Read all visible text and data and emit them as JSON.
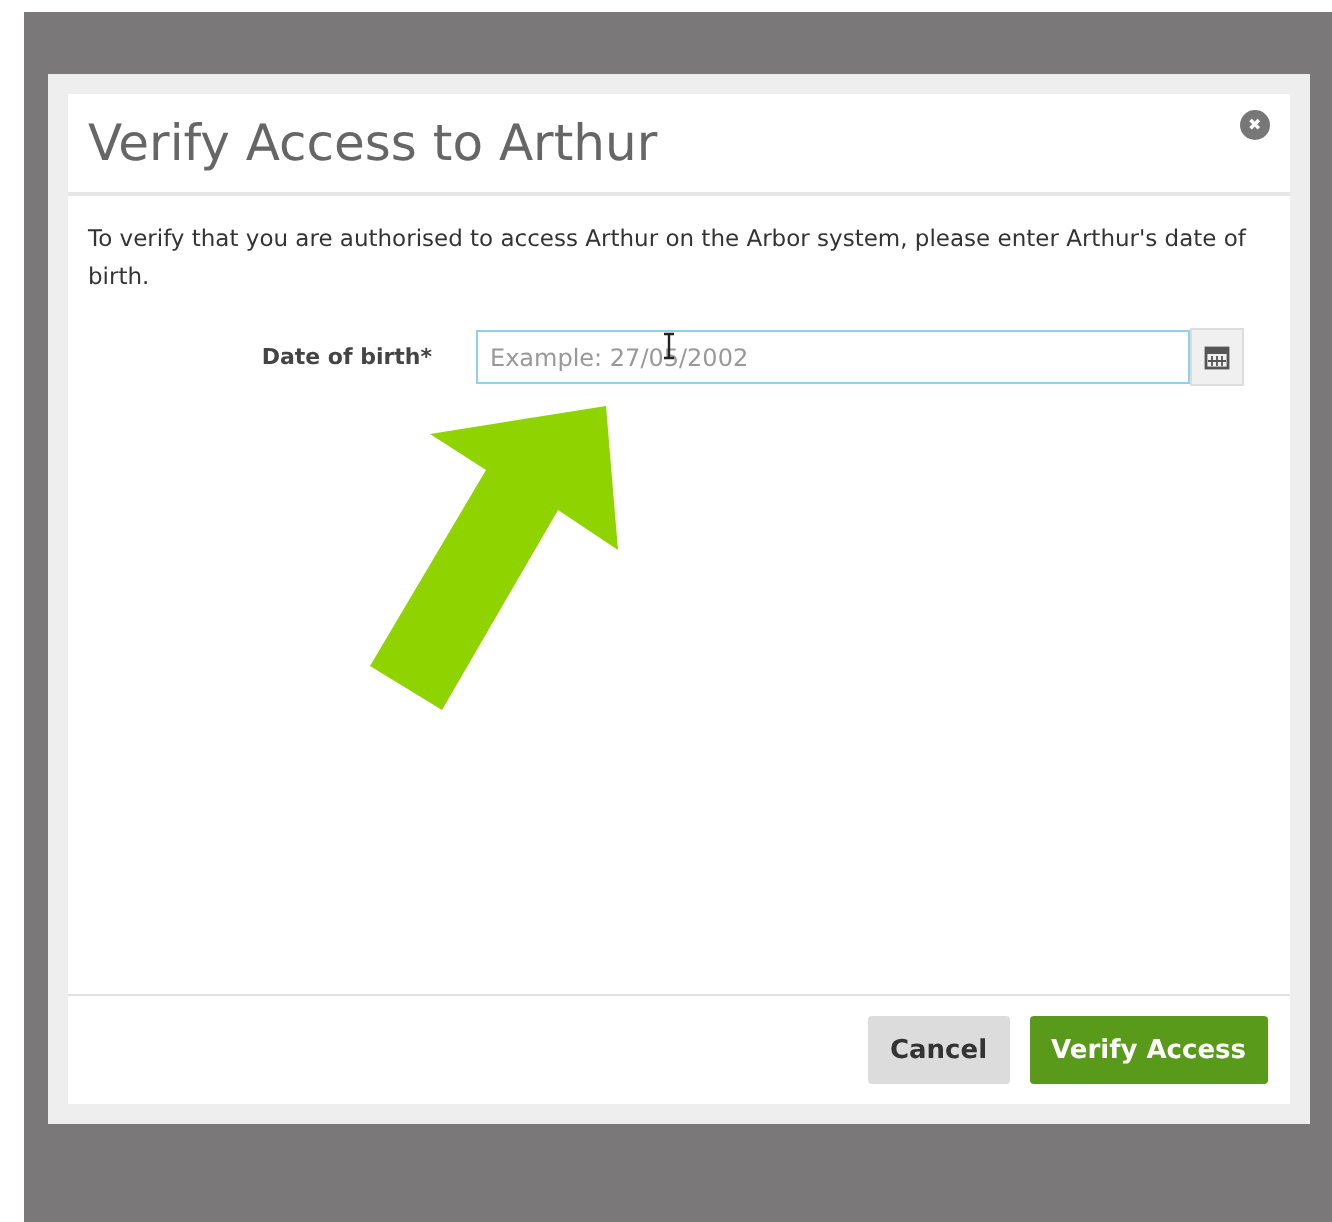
{
  "dialog": {
    "title": "Verify Access to Arthur",
    "close": "✖",
    "message": "To verify that you are authorised to access Arthur on the Arbor system, please enter Arthur's date of birth.",
    "field": {
      "label": "Date of birth*",
      "placeholder": "Example: 27/05/2002"
    },
    "buttons": [
      {
        "label": "Cancel",
        "kind": "secondary"
      },
      {
        "label": "Verify Access",
        "kind": "primary"
      }
    ]
  }
}
